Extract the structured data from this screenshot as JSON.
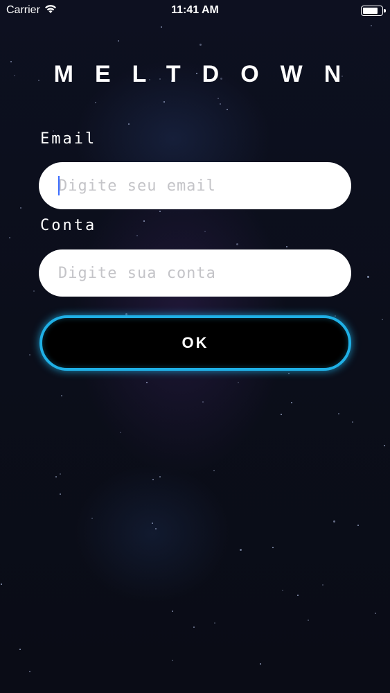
{
  "status_bar": {
    "carrier": "Carrier",
    "time": "11:41 AM",
    "wifi_icon": "wifi-icon",
    "battery_icon": "battery-icon",
    "battery_level": 0.8
  },
  "app": {
    "title": "MELTDOWN"
  },
  "form": {
    "email_label": "Email",
    "email_value": "",
    "email_placeholder": "Digite seu email",
    "account_label": "Conta",
    "account_value": "",
    "account_placeholder": "Digite sua conta",
    "submit_label": "OK"
  },
  "colors": {
    "background": "#0c0f1c",
    "accent": "#1fb0e6",
    "input_background": "#ffffff",
    "caret": "#3a6cff"
  }
}
